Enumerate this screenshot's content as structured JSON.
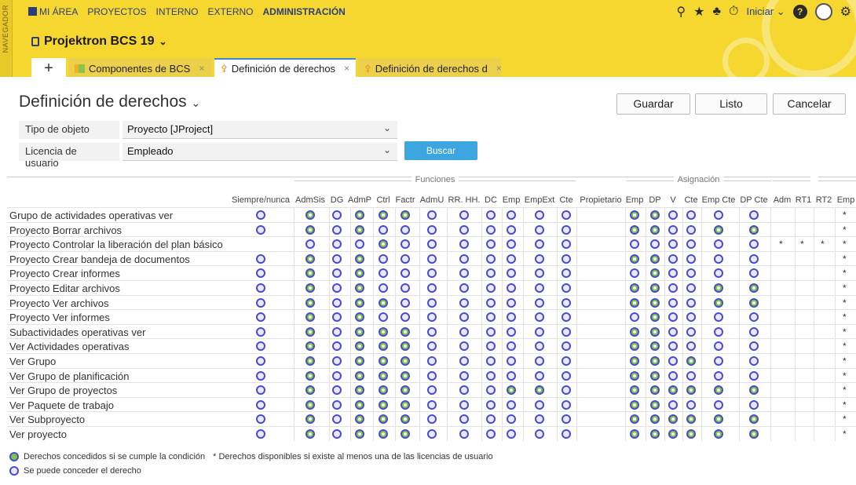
{
  "navigator_label": "NAVEGADOR",
  "mainnav": [
    "MI ÁREA",
    "PROYECTOS",
    "INTERNO",
    "EXTERNO",
    "ADMINISTRACIÓN"
  ],
  "topbar": {
    "start_label": "Iniciar",
    "help": "?"
  },
  "project_title": "Projektron BCS 19",
  "tabs": [
    "Componentes de BCS",
    "Definición de derechos",
    "Definición de derechos d"
  ],
  "page_title": "Definición de derechos",
  "buttons": {
    "save": "Guardar",
    "done": "Listo",
    "cancel": "Cancelar",
    "search": "Buscar"
  },
  "filters": {
    "object_type_label": "Tipo de objeto",
    "object_type_value": "Proyecto [JProject]",
    "license_label": "Licencia de usuario",
    "license_value": "Empleado"
  },
  "groups": {
    "functions": "Funciones",
    "assignment": "Asignación"
  },
  "columns": [
    "Siempre/nunca",
    "AdmSis",
    "DG",
    "AdmP",
    "Ctrl",
    "Factr",
    "AdmU",
    "RR. HH.",
    "DC",
    "Emp",
    "EmpExt",
    "Cte",
    "Propietario",
    "Emp",
    "DP",
    "V",
    "Cte",
    "Emp Cte",
    "DP Cte",
    "Adm",
    "RT1",
    "RT2",
    "Emp"
  ],
  "rows": [
    {
      "label": "Grupo de actividades operativas ver",
      "cells": "o.g.o.g.g.g.o.o.o.o.o.o._.g.g.o.o.o.o._._._.*"
    },
    {
      "label": "Proyecto Borrar archivos",
      "cells": "o.g.o.g.o.o.o.o.o.o.o.o._.g.g.o.o.g.g._._._.*"
    },
    {
      "label": "Proyecto Controlar la liberación del plan básico",
      "cells": "_.o.o.o.g.o.o.o.o.o.o.o._.o.o.o.o.o.o.*.*.*.*"
    },
    {
      "label": "Proyecto Crear bandeja de documentos",
      "cells": "o.g.o.g.o.o.o.o.o.o.o.o._.g.g.o.o.o.o._._._.*"
    },
    {
      "label": "Proyecto Crear informes",
      "cells": "o.g.o.g.o.o.o.o.o.o.o.o._.o.g.o.o.o.o._._._.*"
    },
    {
      "label": "Proyecto Editar archivos",
      "cells": "o.g.o.g.o.o.o.o.o.o.o.o._.g.g.o.o.g.g._._._.*"
    },
    {
      "label": "Proyecto Ver archivos",
      "cells": "o.g.o.g.g.o.o.o.o.o.o.o._.g.g.o.o.g.g._._._.*"
    },
    {
      "label": "Proyecto Ver informes",
      "cells": "o.g.o.g.o.o.o.o.o.o.o.o._.o.g.o.o.o.o._._._.*"
    },
    {
      "label": "Subactividades operativas ver",
      "cells": "o.g.o.g.g.g.o.o.o.o.o.o._.g.g.o.o.o.o._._._.*"
    },
    {
      "label": "Ver Actividades operativas",
      "cells": "o.g.o.g.g.g.o.o.o.o.o.o._.g.g.o.o.o.o._._._.*"
    },
    {
      "label": "Ver Grupo",
      "cells": "o.g.o.g.g.g.o.o.o.o.o.o._.g.g.o.g.o.o._._._.*"
    },
    {
      "label": "Ver Grupo de planificación",
      "cells": "o.g.o.g.g.g.o.o.o.o.o.o._.g.g.o.o.o.o._._._.*"
    },
    {
      "label": "Ver Grupo de proyectos",
      "cells": "o.g.o.g.g.g.o.o.o.g.g.o._.g.g.g.g.g.g._._._.*"
    },
    {
      "label": "Ver Paquete de trabajo",
      "cells": "o.g.o.g.g.g.o.o.o.o.o.o._.g.g.o.o.o.o._._._.*"
    },
    {
      "label": "Ver Subproyecto",
      "cells": "o.g.o.g.g.g.o.o.o.o.o.o._.g.g.g.g.g.g._._._.*"
    },
    {
      "label": "Ver proyecto",
      "cells": "o.g.o.g.g.g.o.o.o.o.o.o._.g.g.g.g.g.g._._._.*"
    }
  ],
  "legend": {
    "granted": "Derechos concedidos si se cumple la condición",
    "available": "* Derechos disponibles si existe al menos una de las licencias de usuario",
    "can_grant": "Se puede conceder el derecho"
  },
  "colors": {
    "top_band": "#f5d730",
    "granted": "#7cc83e",
    "ring": "#4a4ad0",
    "primary_button": "#3da5e0"
  }
}
